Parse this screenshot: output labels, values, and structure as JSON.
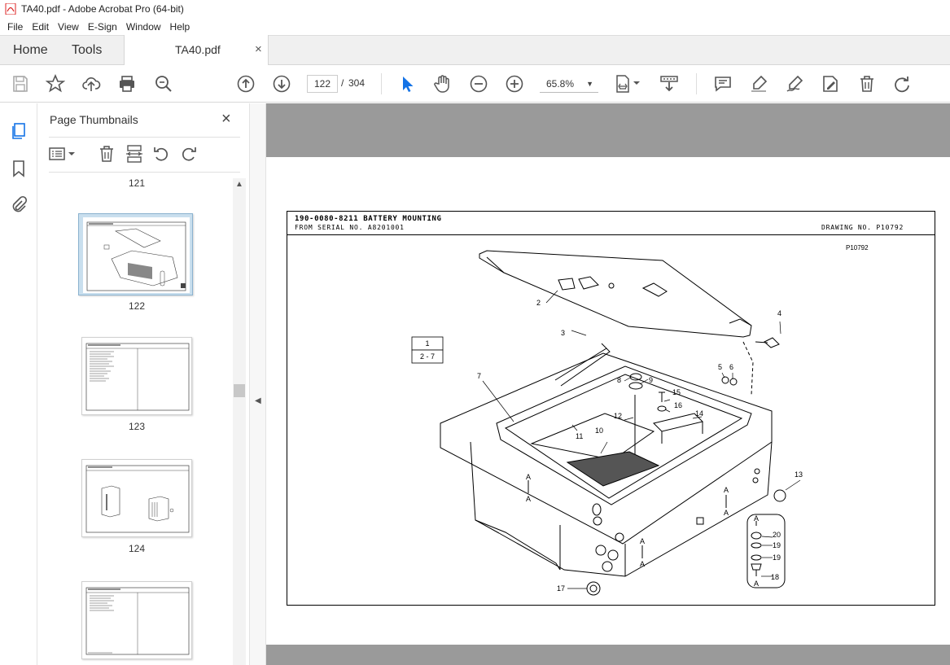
{
  "window": {
    "title": "TA40.pdf - Adobe Acrobat Pro (64-bit)"
  },
  "menu": {
    "items": [
      "File",
      "Edit",
      "View",
      "E-Sign",
      "Window",
      "Help"
    ]
  },
  "tabs": {
    "home": "Home",
    "tools": "Tools",
    "document": "TA40.pdf",
    "close": "×"
  },
  "toolbar": {
    "current_page": "122",
    "separator": "/",
    "total_pages": "304",
    "zoom": "65.8%",
    "icons": [
      "save-icon",
      "star-icon",
      "upload-icon",
      "print-icon",
      "zoom-search-icon",
      "page-up-icon",
      "page-down-icon",
      "select-cursor-icon",
      "hand-icon",
      "zoom-out-icon",
      "zoom-in-icon",
      "fit-page-icon",
      "scroll-mode-icon",
      "comment-icon",
      "highlight-icon",
      "sign-icon",
      "edit-icon",
      "delete-icon",
      "redo-icon"
    ]
  },
  "thumbnails": {
    "title": "Page Thumbnails",
    "close": "×",
    "pages": [
      {
        "label": "121"
      },
      {
        "label": "122",
        "selected": true
      },
      {
        "label": "123"
      },
      {
        "label": "124"
      }
    ]
  },
  "document": {
    "header_title": "190-0080-8211  BATTERY MOUNTING",
    "header_serial": "FROM SERIAL NO. A8201001",
    "drawing_no": "DRAWING NO. P10792",
    "ref": "P10792",
    "table_rows": [
      "1",
      "2 - 7"
    ],
    "callouts": [
      "1",
      "2",
      "3",
      "4",
      "5",
      "6",
      "7",
      "8",
      "9",
      "10",
      "11",
      "12",
      "13",
      "14",
      "15",
      "16",
      "17",
      "18",
      "19",
      "19",
      "20"
    ],
    "section_marks": [
      "A",
      "A",
      "A",
      "A",
      "A",
      "A",
      "A",
      "A"
    ]
  }
}
